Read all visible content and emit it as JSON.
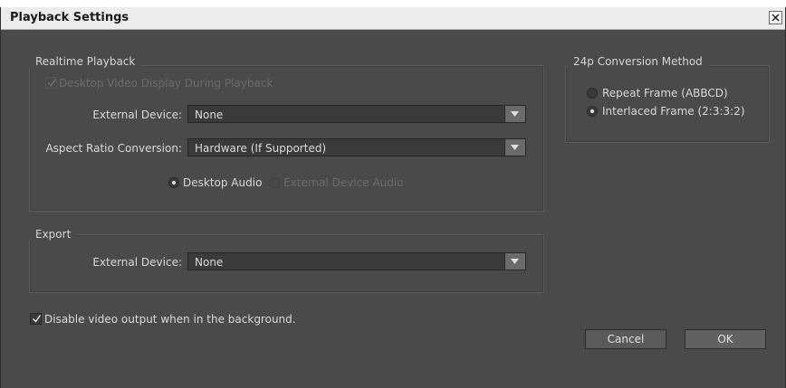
{
  "window": {
    "title": "Playback Settings"
  },
  "realtime": {
    "group_label": "Realtime Playback",
    "desktop_video_label": "Desktop Video Display During Playback",
    "external_device_label": "External Device:",
    "external_device_value": "None",
    "aspect_label": "Aspect Ratio Conversion:",
    "aspect_value": "Hardware (If Supported)",
    "desktop_audio_label": "Desktop Audio",
    "external_audio_label": "External Device Audio"
  },
  "conversion": {
    "group_label": "24p Conversion Method",
    "options": [
      {
        "label": "Repeat Frame (ABBCD)",
        "selected": false
      },
      {
        "label": "Interlaced Frame (2:3:3:2)",
        "selected": true
      }
    ]
  },
  "export": {
    "group_label": "Export",
    "external_device_label": "External Device:",
    "external_device_value": "None"
  },
  "disable_output_label": "Disable video output when in the background.",
  "buttons": {
    "cancel": "Cancel",
    "ok": "OK"
  },
  "icons": {
    "close": "close-icon",
    "dropdown": "chevron-down-icon",
    "check": "check-icon"
  },
  "colors": {
    "panel": "#4a4a4a",
    "titlebar": "#ececec",
    "text": "#d6d6d6",
    "disabled_text": "#6b6b6b"
  }
}
